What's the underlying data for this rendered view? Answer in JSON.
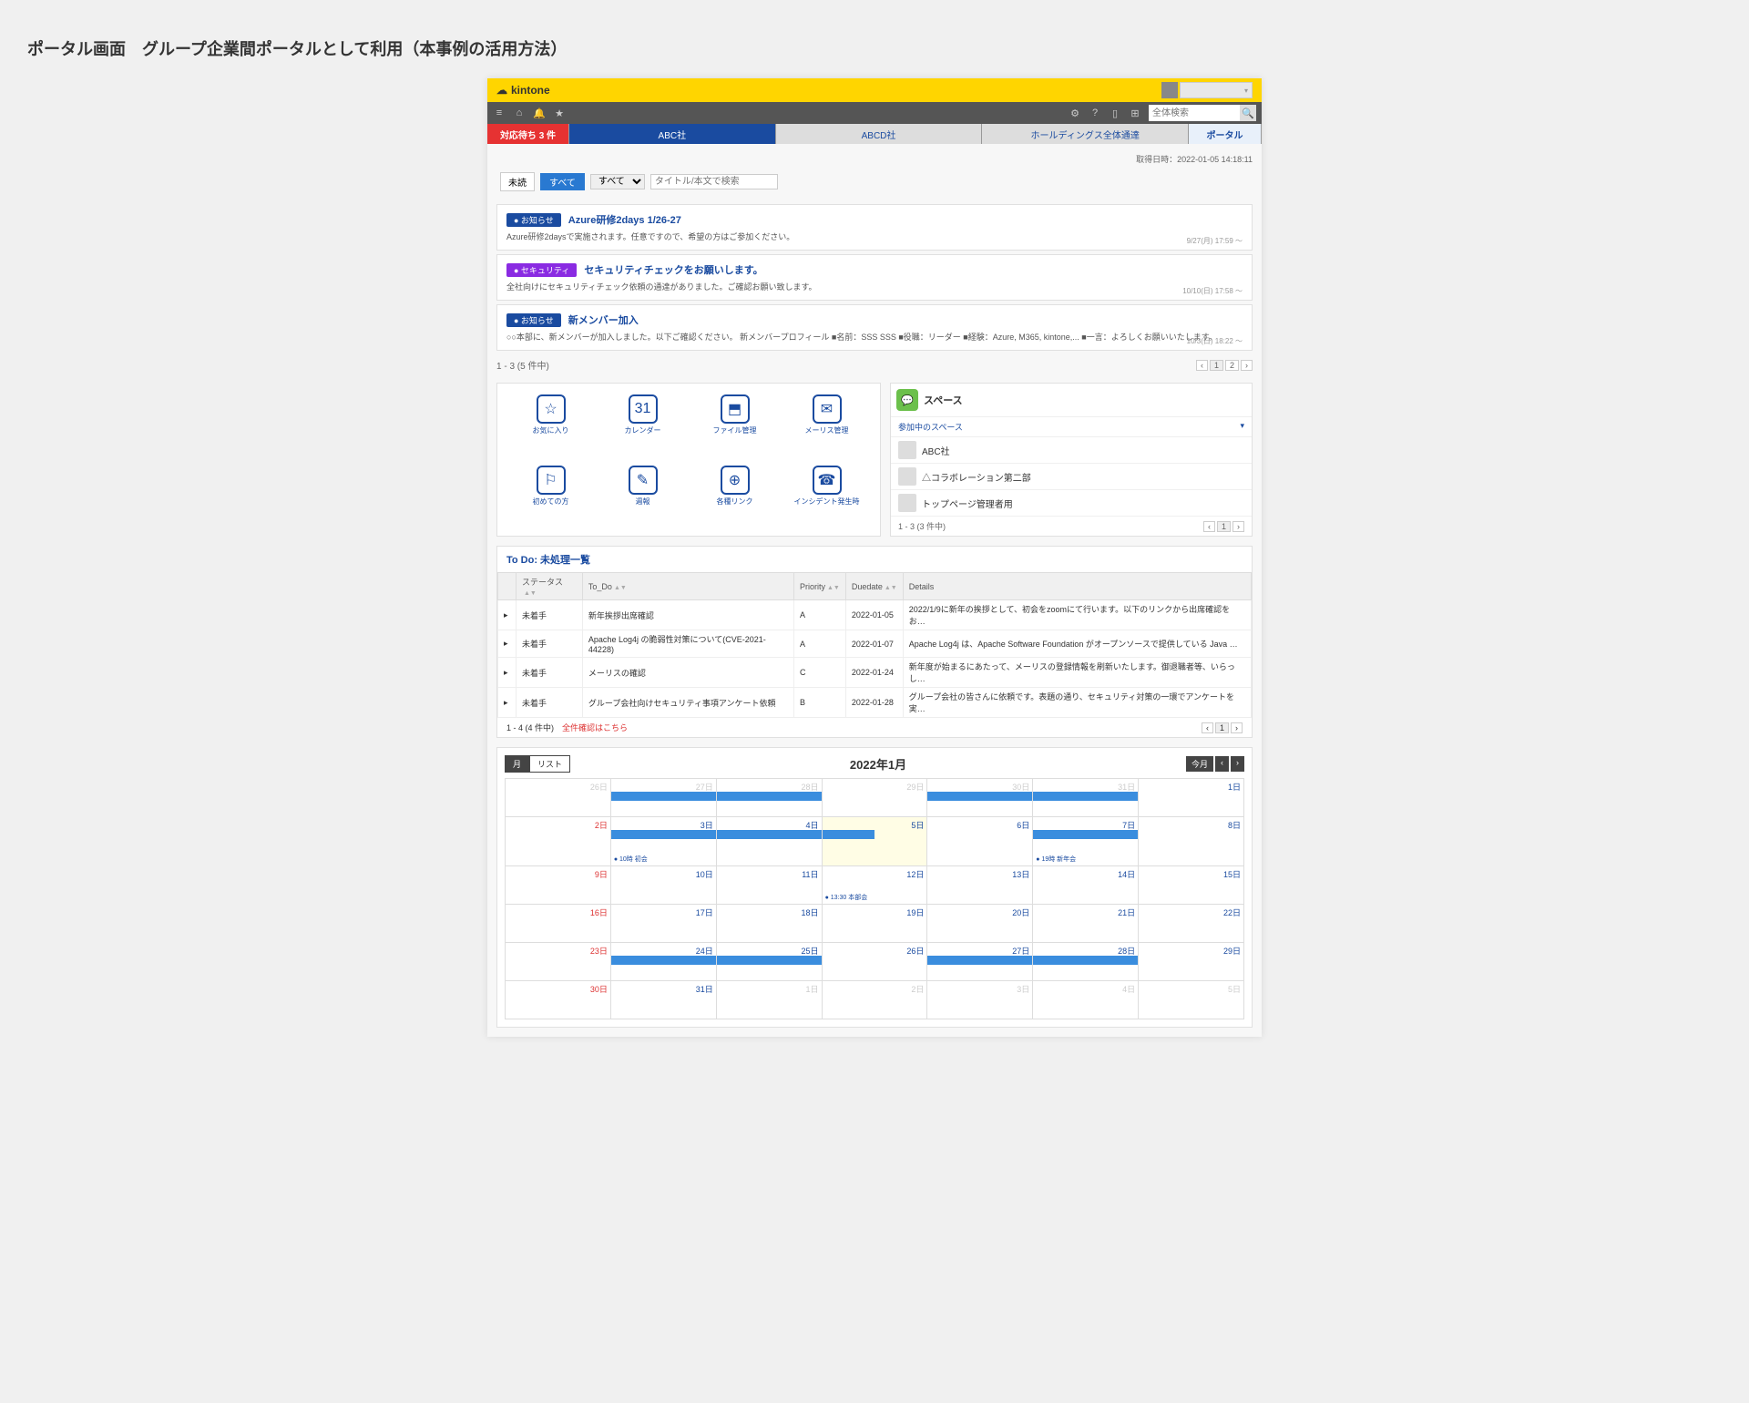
{
  "page_heading": "ポータル画面　グループ企業間ポータルとして利用（本事例の活用方法）",
  "brand": {
    "name": "kintone"
  },
  "toolbar": {
    "search_placeholder": "全体検索"
  },
  "tabs": {
    "pending": "対応待ち 3 件",
    "abc": "ABC社",
    "abcd": "ABCD社",
    "holdings": "ホールディングス全体通達",
    "portal": "ポータル"
  },
  "timestamp": "取得日時：2022-01-05 14:18:11",
  "filters": {
    "unread": "未読",
    "all": "すべて",
    "select": "すべて",
    "search_placeholder": "タイトル/本文で検索"
  },
  "announcements": [
    {
      "badge": "● お知らせ",
      "badge_class": "badge-blue",
      "title": "Azure研修2days 1/26-27",
      "body": "Azure研修2daysで実施されます。任意ですので、希望の方はご参加ください。",
      "date": "9/27(月) 17:59 ～"
    },
    {
      "badge": "● セキュリティ",
      "badge_class": "badge-purple",
      "title": "セキュリティチェックをお願いします。",
      "body": "全社向けにセキュリティチェック依頼の通達がありました。ご確認お願い致します。",
      "date": "10/10(日) 17:58 ～"
    },
    {
      "badge": "● お知らせ",
      "badge_class": "badge-blue",
      "title": "新メンバー加入",
      "body": "○○本部に、新メンバーが加入しました。以下ご確認ください。 新メンバープロフィール ■名前：SSS SSS ■役職：リーダー ■経験：Azure, M365, kintone,... ■一言：よろしくお願いいたします。",
      "date": "10/3(日) 18:22 ～"
    }
  ],
  "announce_pager": {
    "range": "1 - 3 (5 件中)",
    "page1": "1",
    "page2": "2"
  },
  "icons": [
    {
      "glyph": "☆",
      "label": "お気に入り"
    },
    {
      "glyph": "31",
      "label": "カレンダー"
    },
    {
      "glyph": "⬒",
      "label": "ファイル管理"
    },
    {
      "glyph": "✉",
      "label": "メーリス管理"
    },
    {
      "glyph": "⚐",
      "label": "初めての方"
    },
    {
      "glyph": "✎",
      "label": "週報"
    },
    {
      "glyph": "⊕",
      "label": "各種リンク"
    },
    {
      "glyph": "☎",
      "label": "インシデント発生時"
    }
  ],
  "spaces": {
    "title": "スペース",
    "expand": "参加中のスペース",
    "items": [
      "ABC社",
      "△コラボレーション第二部",
      "トップページ管理者用"
    ],
    "pager": "1 - 3 (3 件中)",
    "page": "1"
  },
  "todo": {
    "heading": "To Do: 未処理一覧",
    "cols": {
      "status": "ステータス",
      "todo": "To_Do",
      "priority": "Priority",
      "duedate": "Duedate",
      "details": "Details"
    },
    "rows": [
      {
        "status": "未着手",
        "todo": "新年挨拶出席確認",
        "priority": "A",
        "due": "2022-01-05",
        "details": "2022/1/9に新年の挨拶として、初会をzoomにて行います。以下のリンクから出席確認をお…"
      },
      {
        "status": "未着手",
        "todo": "Apache Log4j の脆弱性対策について(CVE-2021-44228)",
        "priority": "A",
        "due": "2022-01-07",
        "details": "Apache Log4j は、Apache Software Foundation がオープンソースで提供している Java …"
      },
      {
        "status": "未着手",
        "todo": "メーリスの確認",
        "priority": "C",
        "due": "2022-01-24",
        "details": "新年度が始まるにあたって、メーリスの登録情報を刷新いたします。御退職者等、いらっし…"
      },
      {
        "status": "未着手",
        "todo": "グループ会社向けセキュリティ事項アンケート依頼",
        "priority": "B",
        "due": "2022-01-28",
        "details": "グループ会社の皆さんに依頼です。表題の通り、セキュリティ対策の一環でアンケートを実…"
      }
    ],
    "foot_range": "1 - 4 (4 件中)",
    "foot_link": "全件確認はこちら",
    "page": "1"
  },
  "calendar": {
    "views": {
      "month": "月",
      "list": "リスト"
    },
    "title": "2022年1月",
    "today": "今月",
    "events": {
      "e1": "● 10時 初会",
      "e2": "● 13:30 本部会",
      "e3": "● 19時 新年会"
    },
    "dates": {
      "d26": "26日",
      "d27": "27日",
      "d28": "28日",
      "d29": "29日",
      "d30": "30日",
      "d31": "31日",
      "d1": "1日",
      "d2": "2日",
      "d3": "3日",
      "d4": "4日",
      "d5": "5日",
      "d6": "6日",
      "d7": "7日",
      "d8": "8日",
      "d9": "9日",
      "d10": "10日",
      "d11": "11日",
      "d12": "12日",
      "d13": "13日",
      "d14": "14日",
      "d15": "15日",
      "d16": "16日",
      "d17": "17日",
      "d18": "18日",
      "d19": "19日",
      "d20": "20日",
      "d21": "21日",
      "d22": "22日",
      "d23": "23日",
      "d24": "24日",
      "d25": "25日",
      "d26b": "26日",
      "d27b": "27日",
      "d28b": "28日",
      "d29b": "29日",
      "d30b": "30日",
      "d31b": "31日",
      "n1": "1日",
      "n2": "2日",
      "n3": "3日",
      "n4": "4日",
      "n5": "5日"
    }
  }
}
